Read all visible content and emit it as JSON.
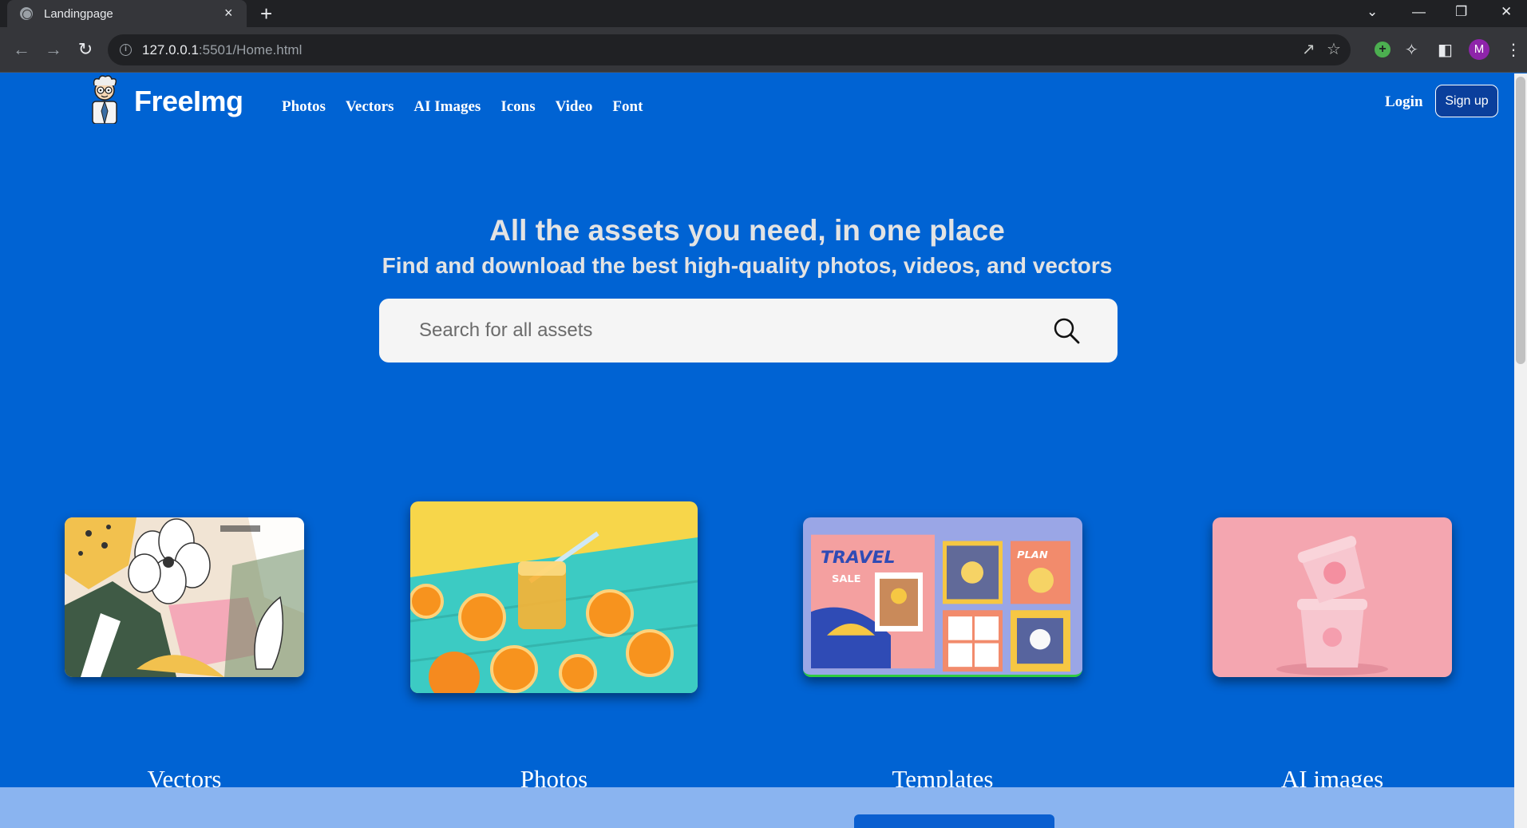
{
  "browser": {
    "tab_title": "Landingpage",
    "tab_close": "×",
    "new_tab": "+",
    "url_host": "127.0.0.1",
    "url_rest": ":5501/Home.html",
    "profile_initial": "M"
  },
  "site": {
    "brand": "FreeImg",
    "nav": [
      "Photos",
      "Vectors",
      "AI Images",
      "Icons",
      "Video",
      "Font"
    ],
    "login": "Login",
    "signup": "Sign up"
  },
  "hero": {
    "title": "All the assets you need, in one place",
    "subtitle": "Find and download the best high-quality photos, videos, and vectors",
    "search_placeholder": "Search for all assets"
  },
  "categories": [
    {
      "label": "Vectors"
    },
    {
      "label": "Photos"
    },
    {
      "label": "Templates"
    },
    {
      "label": "AI images"
    }
  ],
  "card_art": {
    "templates": {
      "travel": "TRAVEL",
      "sale": "SALE",
      "plan": "PLAN"
    }
  },
  "colors": {
    "page_bg": "#0063d3",
    "hero_text": "#e3e3e3",
    "signup_bg": "#0a3f9c",
    "footer_band": "#8ab4f0"
  }
}
